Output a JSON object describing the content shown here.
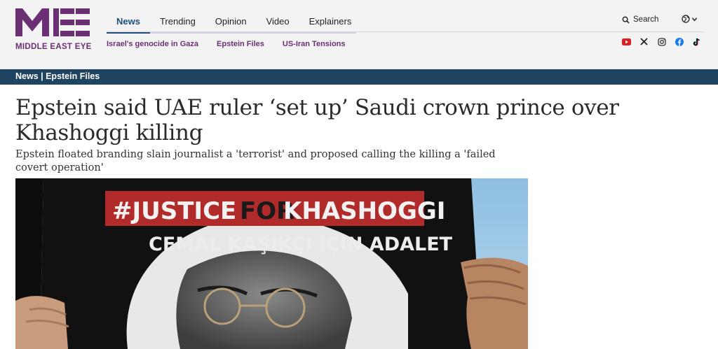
{
  "brand": {
    "logo_name": "Middle East Eye",
    "logo_text": "MIDDLE EAST EYE",
    "accent": "#6b3074"
  },
  "nav": {
    "items": [
      {
        "label": "News"
      },
      {
        "label": "Trending"
      },
      {
        "label": "Opinion"
      },
      {
        "label": "Video"
      },
      {
        "label": "Explainers"
      }
    ]
  },
  "topics": [
    {
      "label": "Israel's genocide in Gaza"
    },
    {
      "label": "Epstein Files"
    },
    {
      "label": "US-Iran Tensions"
    }
  ],
  "search": {
    "label": "Search"
  },
  "social_icons": [
    "youtube-icon",
    "x-icon",
    "instagram-icon",
    "facebook-icon",
    "tiktok-icon"
  ],
  "section": {
    "label": "News | Epstein Files"
  },
  "article": {
    "headline": "Epstein said UAE ruler ‘set up’ Saudi crown prince over Khashoggi killing",
    "subheadline": "Epstein floated branding slain journalist a 'terrorist' and proposed calling the killing a 'failed covert operation'"
  },
  "hero": {
    "sign_hashtag_left": "#JUSTICE",
    "sign_hashtag_mid": "FOR",
    "sign_hashtag_right": "KHASHOGGI",
    "sign_line2": "CEMAL KAŞIKÇI IÇIN ADALET"
  }
}
